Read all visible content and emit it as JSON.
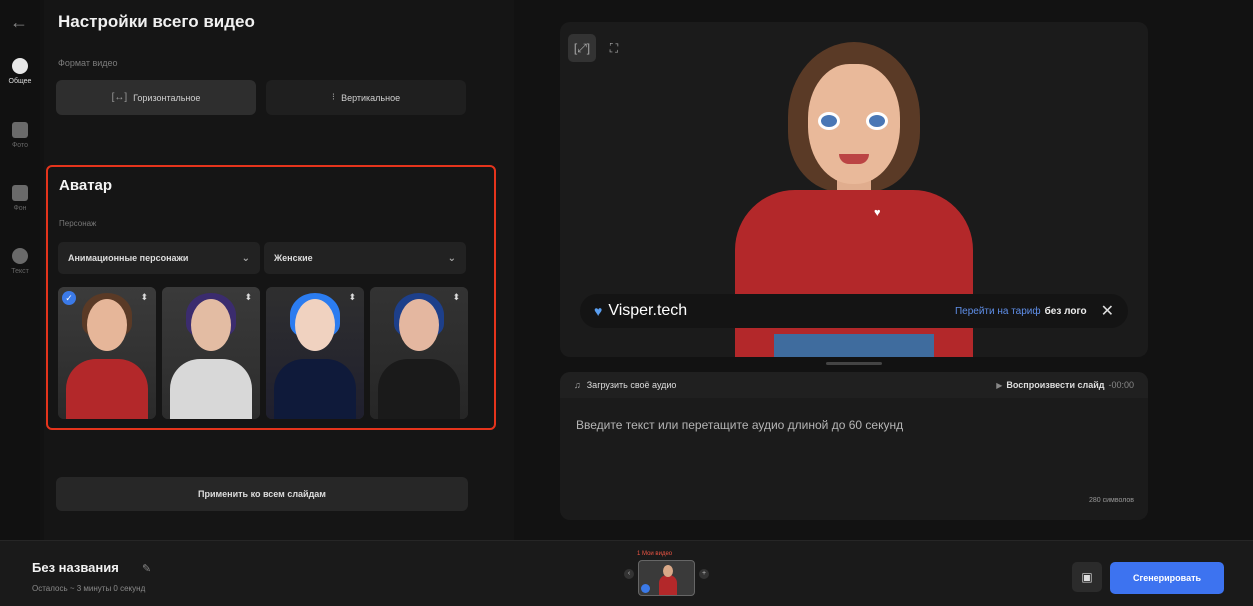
{
  "rail": {
    "items": [
      {
        "label": "Общее",
        "icon": "settings-icon"
      },
      {
        "label": "Фото",
        "icon": "image-icon"
      },
      {
        "label": "Фон",
        "icon": "background-icon"
      },
      {
        "label": "Текст",
        "icon": "text-icon"
      }
    ]
  },
  "settings": {
    "title": "Настройки всего видео",
    "format_label": "Формат видео",
    "format_horizontal": "Горизонтальное",
    "format_vertical": "Вертикальное"
  },
  "avatar": {
    "title": "Аватар",
    "character_label": "Персонаж",
    "type_select": "Анимационные персонажи",
    "gender_select": "Женские",
    "cards": [
      {
        "name": "avatar-red-sweater",
        "selected": true
      },
      {
        "name": "avatar-white-shirt",
        "selected": false
      },
      {
        "name": "avatar-blue-hair",
        "selected": false
      },
      {
        "name": "avatar-dark-hair",
        "selected": false
      }
    ]
  },
  "apply_label": "Применить ко всем слайдам",
  "preview": {
    "brand": "Visper.tech",
    "upgrade_link": "Перейти на тариф",
    "upgrade_suffix": "без лого",
    "close_symbol": "✕"
  },
  "script": {
    "upload_label": "Загрузить своё аудио",
    "play_label": "Воспроизвести слайд",
    "time": "-00:00",
    "placeholder": "Введите текст или перетащите аудио длиной до 60 секунд",
    "char_count": "280 символов"
  },
  "footer": {
    "project_title": "Без названия",
    "remaining": "Осталось ~ 3 минуты 0 секунд",
    "timeline_label": "1 Мои видео",
    "generate_label": "Сгенерировать"
  },
  "colors": {
    "accent": "#3d73f0",
    "highlight_border": "#e5341c"
  }
}
